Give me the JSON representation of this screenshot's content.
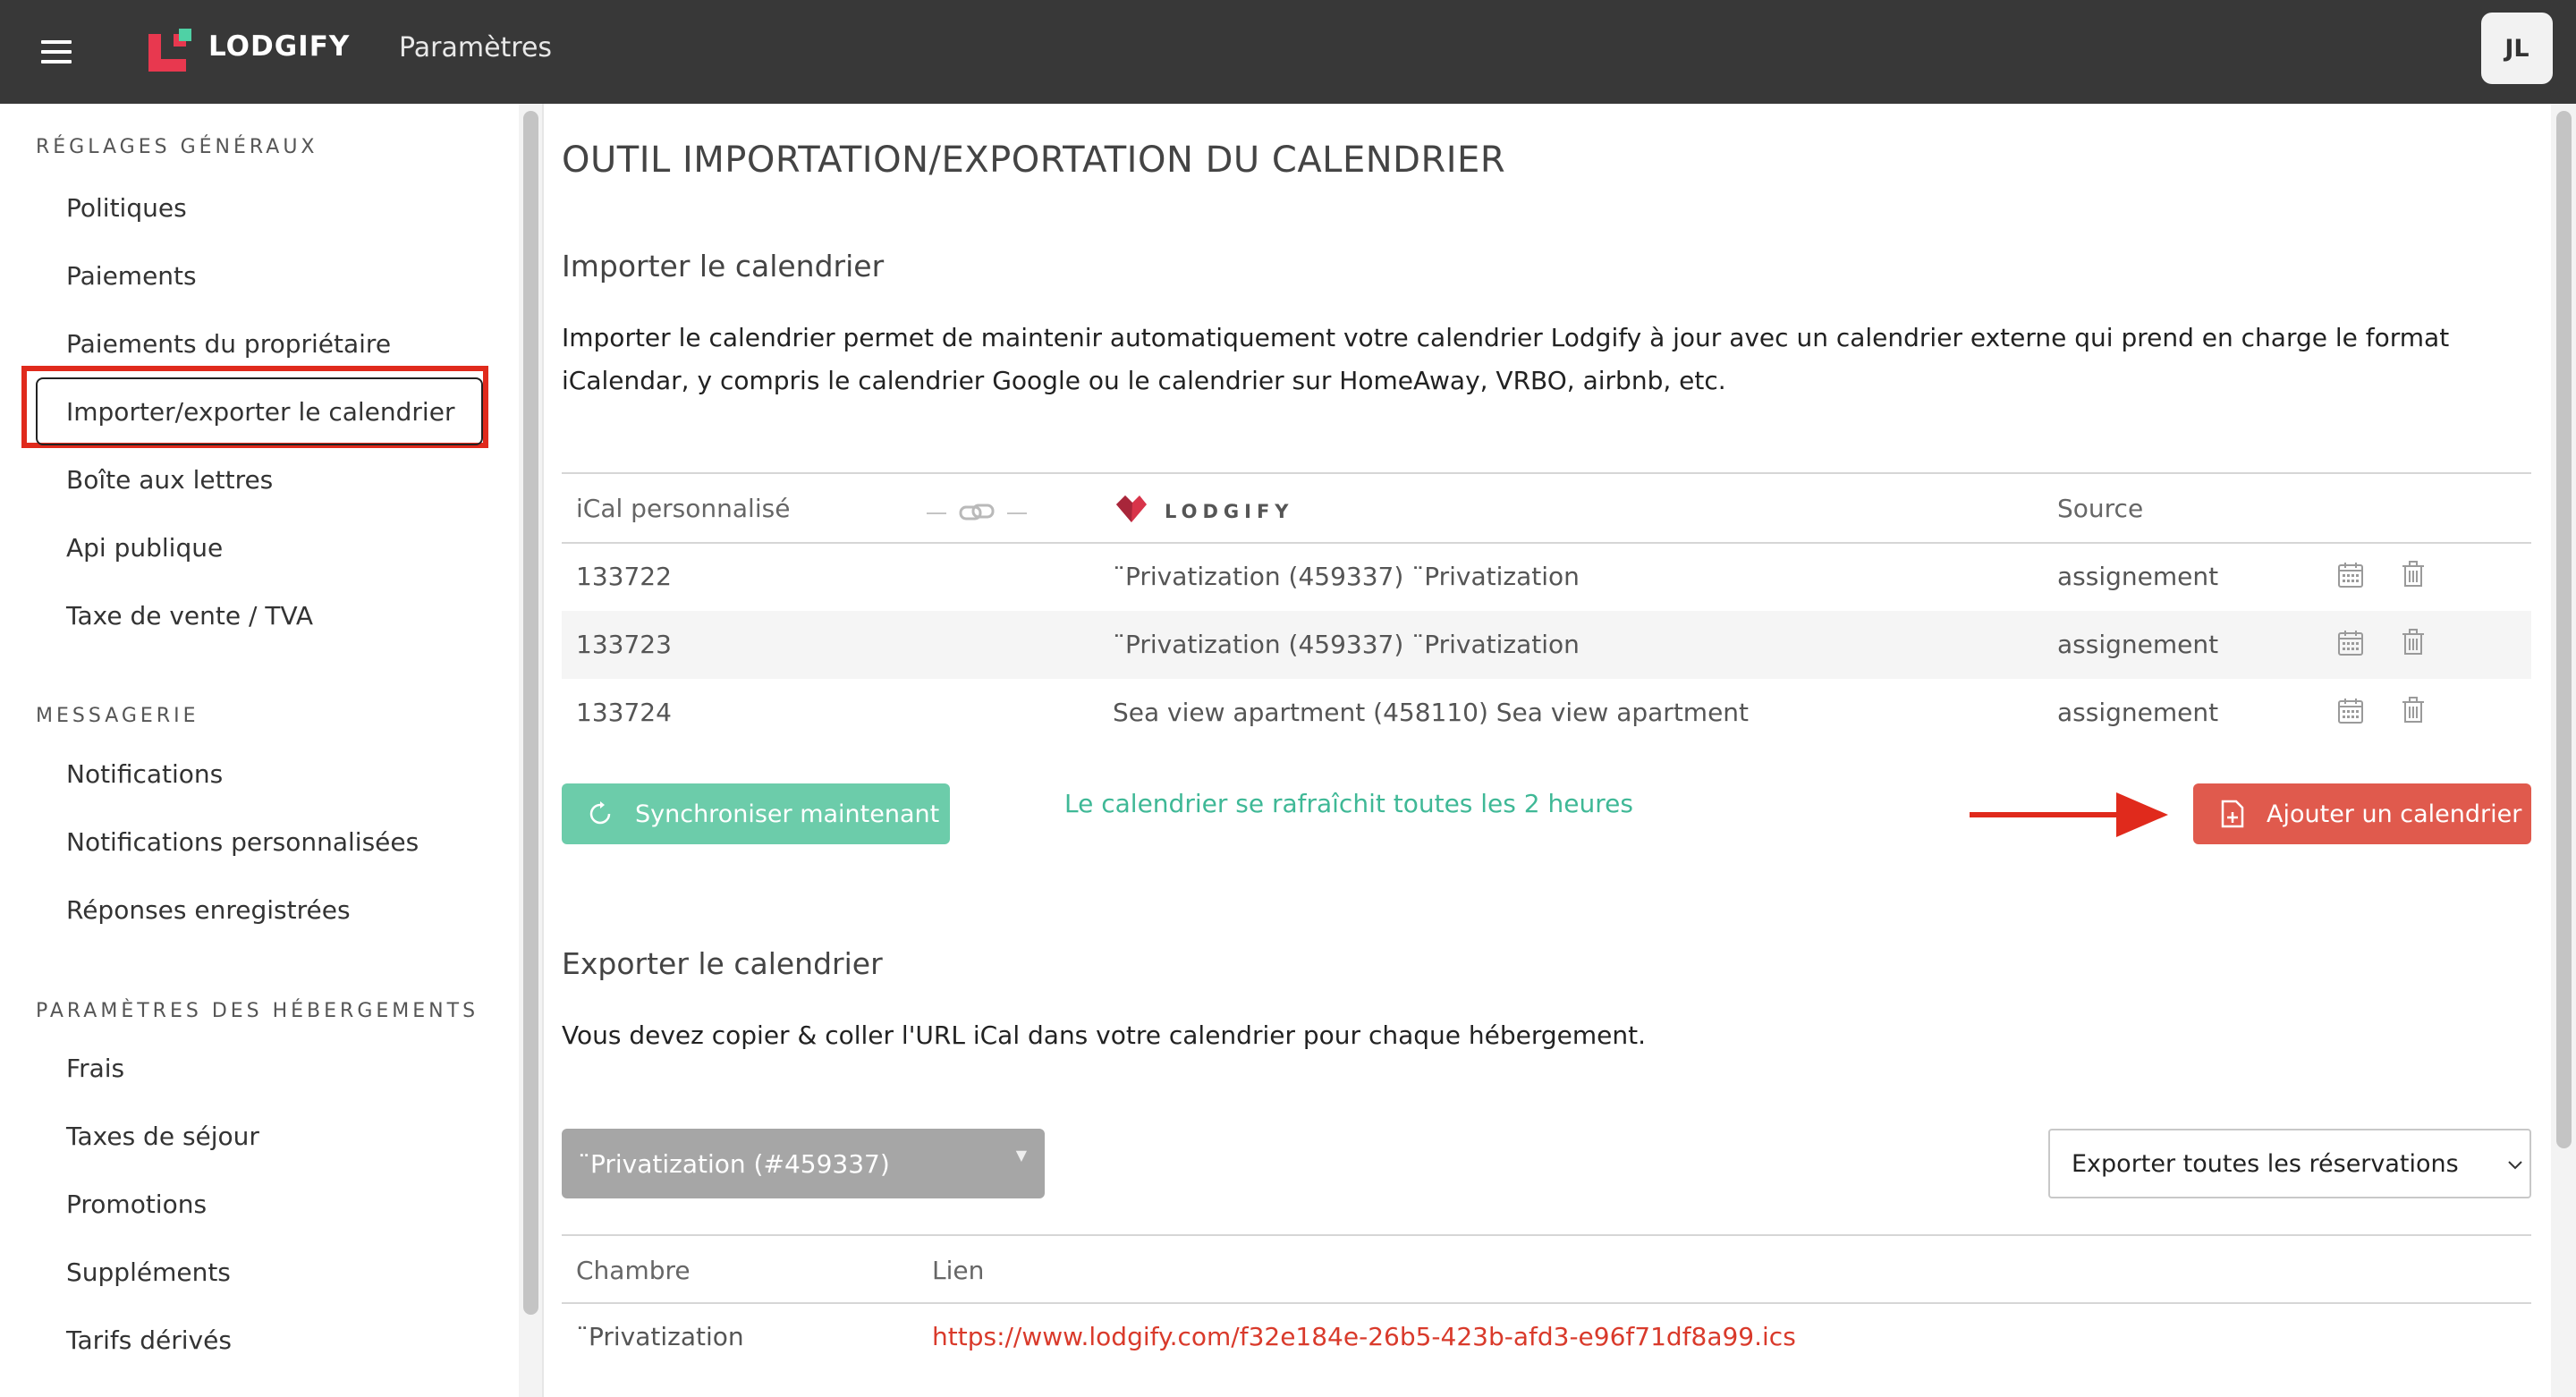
{
  "header": {
    "brand": "LODGIFY",
    "title": "Paramètres",
    "avatar_initials": "JL"
  },
  "sidebar": {
    "sections": [
      {
        "heading": "RÉGLAGES GÉNÉRAUX",
        "items": [
          "Politiques",
          "Paiements",
          "Paiements du propriétaire",
          "Importer/exporter le calendrier",
          "Boîte aux lettres",
          "Api publique",
          "Taxe de vente / TVA"
        ]
      },
      {
        "heading": "MESSAGERIE",
        "items": [
          "Notifications",
          "Notifications personnalisées",
          "Réponses enregistrées"
        ]
      },
      {
        "heading": "PARAMÈTRES DES HÉBERGEMENTS",
        "items": [
          "Frais",
          "Taxes de séjour",
          "Promotions",
          "Suppléments",
          "Tarifs dérivés"
        ]
      }
    ],
    "active_item": "Importer/exporter le calendrier"
  },
  "main": {
    "page_title": "OUTIL IMPORTATION/EXPORTATION DU CALENDRIER",
    "import": {
      "heading": "Importer le calendrier",
      "description_line1": "Importer le calendrier permet de maintenir automatiquement votre calendrier Lodgify à jour avec un calendrier externe qui prend en charge le format",
      "description_line2": "iCalendar, y compris le calendrier Google ou le calendrier sur HomeAway, VRBO, airbnb, etc.",
      "columns": {
        "ical": "iCal personnalisé",
        "lodgify": "LODGIFY",
        "source": "Source"
      },
      "rows": [
        {
          "id": "133722",
          "property": "¨Privatization (459337) ¨Privatization",
          "source": "assignement"
        },
        {
          "id": "133723",
          "property": "¨Privatization (459337) ¨Privatization",
          "source": "assignement"
        },
        {
          "id": "133724",
          "property": "Sea view apartment (458110) Sea view apartment",
          "source": "assignement"
        }
      ],
      "sync_button": "Synchroniser maintenant",
      "refresh_note": "Le calendrier se rafraîchit toutes les 2 heures",
      "add_button": "Ajouter un calendrier"
    },
    "export": {
      "heading": "Exporter le calendrier",
      "description": "Vous devez copier & coller l'URL iCal dans votre calendrier pour chaque hébergement.",
      "property_select": "¨Privatization (#459337)",
      "reservations_select": "Exporter toutes les réservations",
      "columns": {
        "room": "Chambre",
        "link": "Lien"
      },
      "rows": [
        {
          "room": "¨Privatization",
          "link": "https://www.lodgify.com/f32e184e-26b5-423b-afd3-e96f71df8a99.ics"
        }
      ]
    }
  },
  "colors": {
    "topbar": "#383838",
    "sync_green": "#6cccaa",
    "add_red": "#e05a4d",
    "highlight_red": "#e02a1c",
    "link_red": "#d93a2b"
  }
}
